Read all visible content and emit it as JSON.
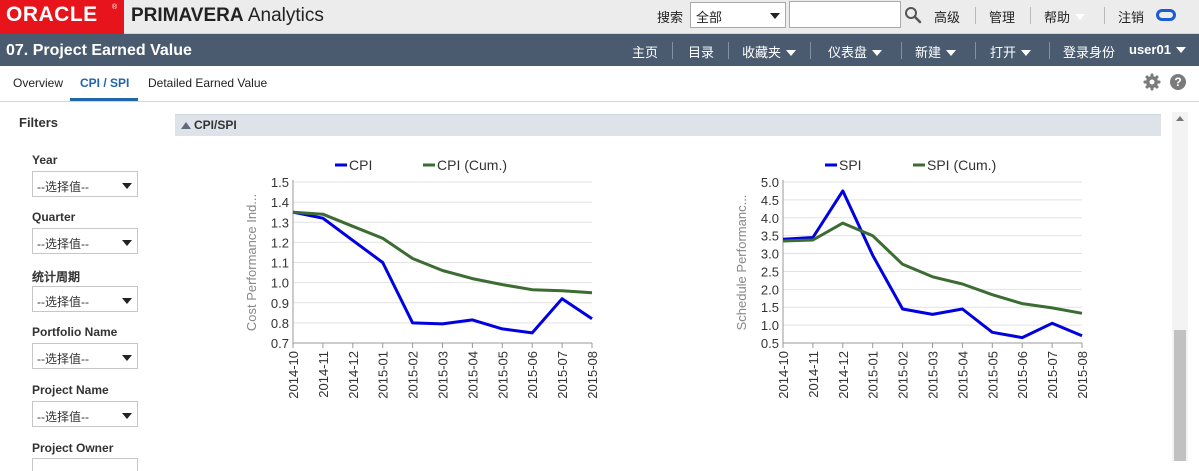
{
  "header": {
    "brand": "ORACLE",
    "product_bold": "PRIMAVERA",
    "product_rest": "Analytics",
    "search_label": "搜索",
    "scope_value": "全部",
    "search_value": "",
    "links": {
      "advanced": "高级",
      "manage": "管理",
      "help": "帮助",
      "logout": "注销"
    },
    "colors": {
      "brand_red": "#e8141b",
      "ring_blue": "#1a5bd6"
    }
  },
  "dashboard": {
    "title": "07. Project Earned Value",
    "nav": {
      "home": "主页",
      "catalog": "目录",
      "favorites": "收藏夹",
      "dashboards": "仪表盘",
      "new": "新建",
      "open": "打开",
      "signed_in_as": "登录身份",
      "user": "user01"
    }
  },
  "tabs": {
    "overview": "Overview",
    "cpi_spi": "CPI / SPI",
    "detailed": "Detailed Earned Value"
  },
  "filters": {
    "title": "Filters",
    "items": [
      {
        "label": "Year",
        "value": "--选择值--"
      },
      {
        "label": "Quarter",
        "value": "--选择值--"
      },
      {
        "label": "统计周期",
        "value": "--选择值--"
      },
      {
        "label": "Portfolio Name",
        "value": "--选择值--"
      },
      {
        "label": "Project Name",
        "value": "--选择值--"
      },
      {
        "label": "Project Owner",
        "value": ""
      }
    ]
  },
  "section": {
    "title": "CPI/SPI"
  },
  "chart_data": [
    {
      "type": "line",
      "title": "",
      "xlabel": "",
      "ylabel": "Cost Performance Ind...",
      "categories": [
        "2014-10",
        "2014-11",
        "2014-12",
        "2015-01",
        "2015-02",
        "2015-03",
        "2015-04",
        "2015-05",
        "2015-06",
        "2015-07",
        "2015-08"
      ],
      "ylim": [
        0.7,
        1.5
      ],
      "yticks": [
        "0.7",
        "0.8",
        "0.9",
        "1.0",
        "1.1",
        "1.2",
        "1.3",
        "1.4",
        "1.5"
      ],
      "grid": true,
      "legend": "top",
      "series": [
        {
          "name": "CPI",
          "color": "#0000e0",
          "values": [
            1.35,
            1.32,
            1.21,
            1.1,
            0.8,
            0.795,
            0.815,
            0.77,
            0.75,
            0.92,
            0.82
          ]
        },
        {
          "name": "CPI (Cum.)",
          "color": "#3b6c32",
          "values": [
            1.35,
            1.34,
            1.28,
            1.22,
            1.12,
            1.06,
            1.02,
            0.99,
            0.965,
            0.96,
            0.95
          ]
        }
      ]
    },
    {
      "type": "line",
      "title": "",
      "xlabel": "",
      "ylabel": "Schedule Performanc...",
      "categories": [
        "2014-10",
        "2014-11",
        "2014-12",
        "2015-01",
        "2015-02",
        "2015-03",
        "2015-04",
        "2015-05",
        "2015-06",
        "2015-07",
        "2015-08"
      ],
      "ylim": [
        0.5,
        5.0
      ],
      "yticks": [
        "0.5",
        "1.0",
        "1.5",
        "2.0",
        "2.5",
        "3.0",
        "3.5",
        "4.0",
        "4.5",
        "5.0"
      ],
      "grid": true,
      "legend": "top",
      "series": [
        {
          "name": "SPI",
          "color": "#0000e0",
          "values": [
            3.4,
            3.45,
            4.75,
            2.95,
            1.45,
            1.3,
            1.45,
            0.8,
            0.65,
            1.05,
            0.7
          ]
        },
        {
          "name": "SPI (Cum.)",
          "color": "#3b6c32",
          "values": [
            3.35,
            3.38,
            3.85,
            3.5,
            2.7,
            2.35,
            2.15,
            1.85,
            1.6,
            1.48,
            1.33
          ]
        }
      ]
    }
  ]
}
